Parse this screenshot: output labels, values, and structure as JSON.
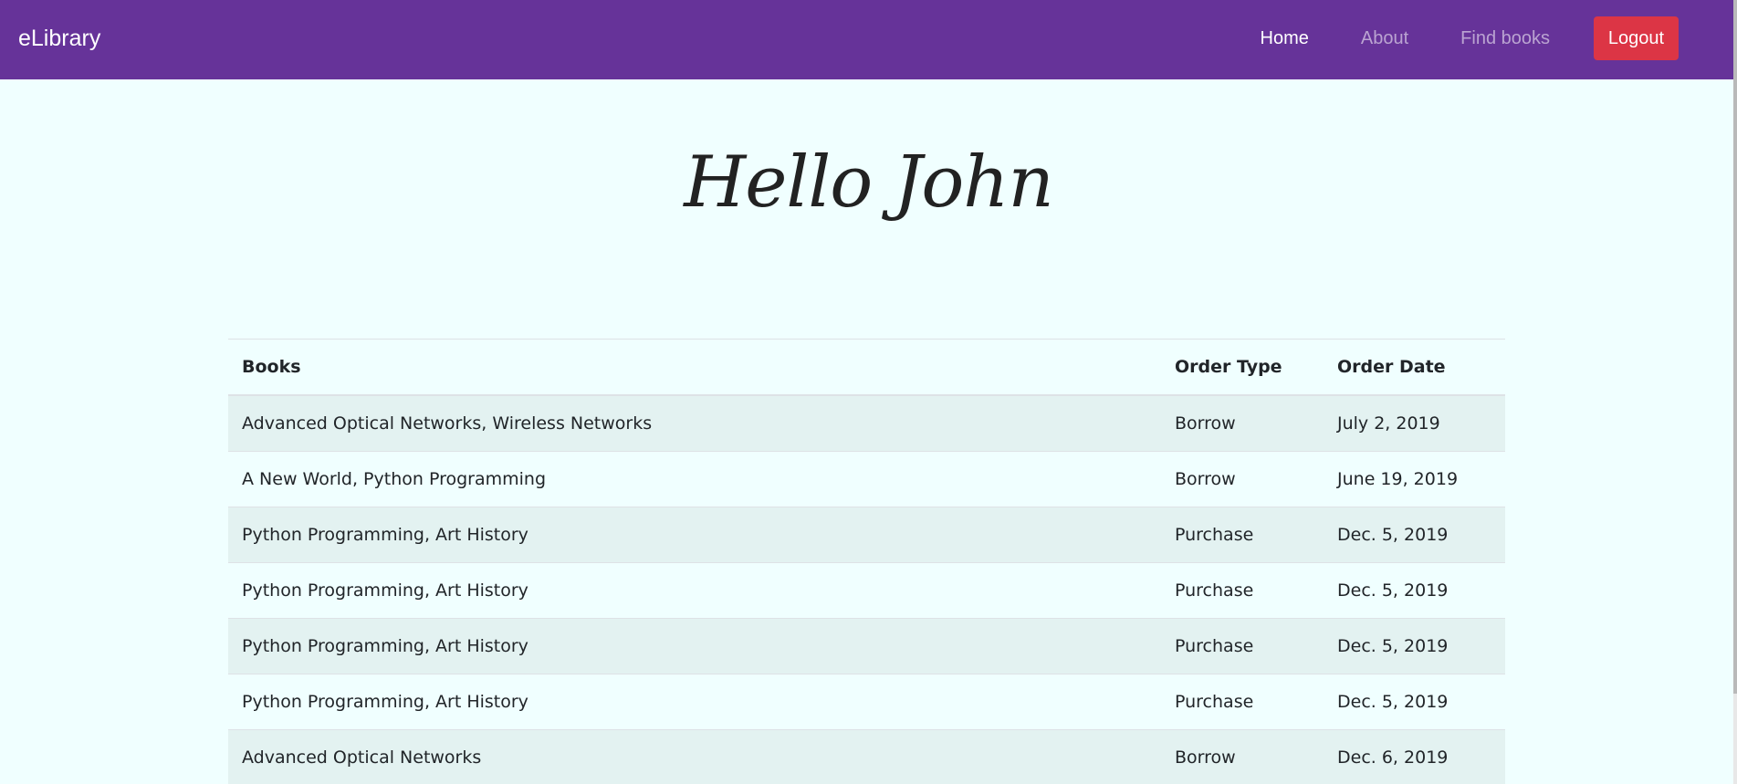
{
  "navbar": {
    "brand": "eLibrary",
    "links": {
      "home": "Home",
      "about": "About",
      "find_books": "Find books"
    },
    "logout_label": "Logout",
    "background": "#663399",
    "logout_color": "#dc3545"
  },
  "main": {
    "greeting": "Hello John"
  },
  "orders_table": {
    "headers": {
      "books": "Books",
      "order_type": "Order Type",
      "order_date": "Order Date"
    },
    "rows": [
      {
        "books": "Advanced Optical Networks, Wireless Networks",
        "order_type": "Borrow",
        "order_date": "July 2, 2019"
      },
      {
        "books": "A New World, Python Programming",
        "order_type": "Borrow",
        "order_date": "June 19, 2019"
      },
      {
        "books": "Python Programming, Art History",
        "order_type": "Purchase",
        "order_date": "Dec. 5, 2019"
      },
      {
        "books": "Python Programming, Art History",
        "order_type": "Purchase",
        "order_date": "Dec. 5, 2019"
      },
      {
        "books": "Python Programming, Art History",
        "order_type": "Purchase",
        "order_date": "Dec. 5, 2019"
      },
      {
        "books": "Python Programming, Art History",
        "order_type": "Purchase",
        "order_date": "Dec. 5, 2019"
      },
      {
        "books": "Advanced Optical Networks",
        "order_type": "Borrow",
        "order_date": "Dec. 6, 2019"
      }
    ]
  },
  "colors": {
    "page_background": "#f0ffff",
    "striped_row": "#e3f2f1"
  }
}
